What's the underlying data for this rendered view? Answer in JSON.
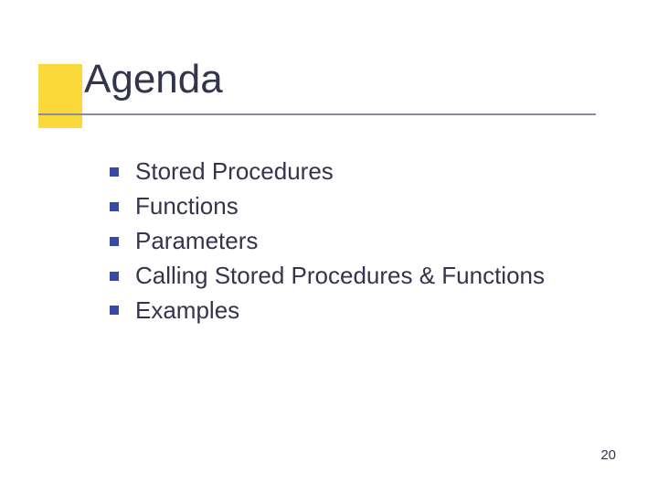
{
  "title": "Agenda",
  "items": [
    {
      "label": "Stored Procedures"
    },
    {
      "label": "Functions"
    },
    {
      "label": "Parameters"
    },
    {
      "label": "Calling Stored Procedures & Functions"
    },
    {
      "label": "Examples"
    }
  ],
  "page_number": "20"
}
